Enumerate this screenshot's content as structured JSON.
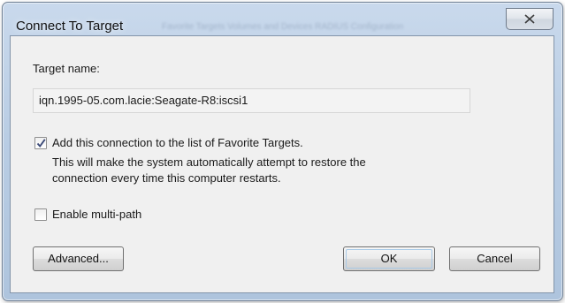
{
  "window": {
    "title": "Connect To Target",
    "background_tabs_text": "Favorite Targets   Volumes and Devices   RADIUS   Configuration"
  },
  "title_controls": {
    "close_icon": "close-x-icon"
  },
  "form": {
    "target_name_label": "Target name:",
    "target_name_value": "iqn.1995-05.com.lacie:Seagate-R8:iscsi1",
    "favorites": {
      "checked": true,
      "label": "Add this connection to the list of Favorite Targets.",
      "description_line1": "This will make the system automatically attempt to restore the",
      "description_line2": "connection every time this computer restarts."
    },
    "multipath": {
      "checked": false,
      "label": "Enable multi-path"
    }
  },
  "buttons": {
    "advanced": "Advanced...",
    "ok": "OK",
    "cancel": "Cancel"
  }
}
